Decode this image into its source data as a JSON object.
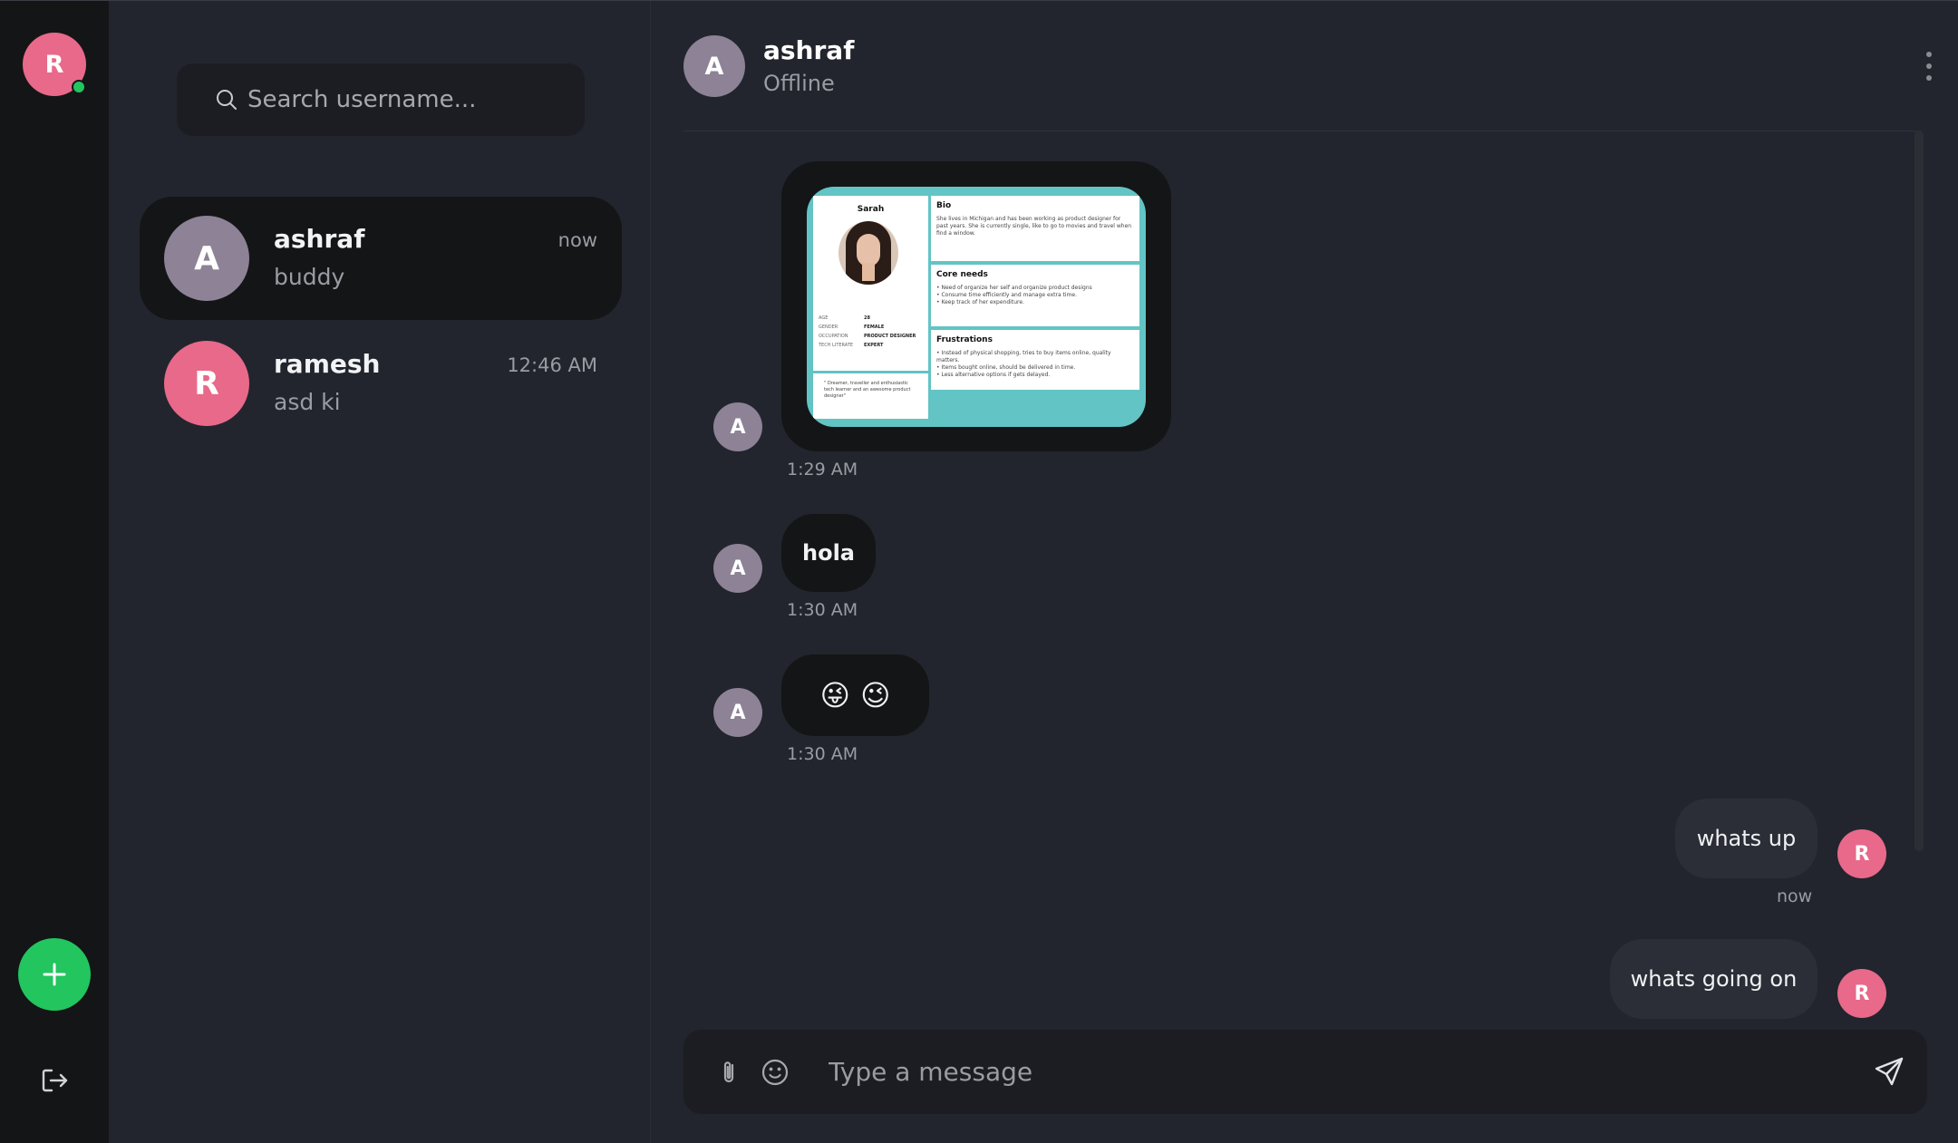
{
  "user": {
    "initial": "R"
  },
  "search": {
    "placeholder": "Search username..."
  },
  "contacts": [
    {
      "initial": "A",
      "name": "ashraf",
      "preview": "buddy",
      "time": "now",
      "color": "#8d8296"
    },
    {
      "initial": "R",
      "name": "ramesh",
      "preview": "asd ki",
      "time": "12:46 AM",
      "color": "#e8698a"
    }
  ],
  "chat": {
    "initial": "A",
    "name": "ashraf",
    "status": "Offline"
  },
  "persona": {
    "name": "Sarah",
    "bio_title": "Bio",
    "bio_text": "She lives in Michigan and has been working as product designer for past years. She is currently single, like to go to movies and travel when find a window.",
    "needs_title": "Core needs",
    "needs": [
      "Need of organize her self and organize product designs",
      "Consume time efficiently and manage extra time.",
      "Keep track of her expenditure."
    ],
    "frustrations_title": "Frustrations",
    "frustrations": [
      "Instead of physical shopping, tries to buy items online, quality matters.",
      "Items bought online, should be delivered in time.",
      "Less alternative options if gets delayed."
    ],
    "attrs": [
      {
        "k": "AGE",
        "v": "28"
      },
      {
        "k": "GENDER",
        "v": "FEMALE"
      },
      {
        "k": "OCCUPATION",
        "v": "PRODUCT DESIGNER"
      },
      {
        "k": "TECH LITERATE",
        "v": "EXPERT"
      }
    ],
    "quote": "\" Dreamer, traveller and enthusiastic tech learner and an awesome product designer\""
  },
  "messages": [
    {
      "type": "image",
      "time": "1:29 AM"
    },
    {
      "type": "text",
      "text": "hola",
      "time": "1:30 AM"
    },
    {
      "type": "emoji",
      "text": "😜 😉",
      "time": "1:30 AM"
    },
    {
      "type": "text",
      "text": "whats up",
      "time": "now",
      "from": "R"
    },
    {
      "type": "text",
      "text": "whats going on",
      "from": "R"
    }
  ],
  "composer": {
    "placeholder": "Type a message"
  },
  "colors": {
    "accent": "#22c55e",
    "avatar_a": "#8d8296",
    "avatar_r": "#e8698a",
    "panel": "#22252d",
    "rail": "#141517"
  }
}
